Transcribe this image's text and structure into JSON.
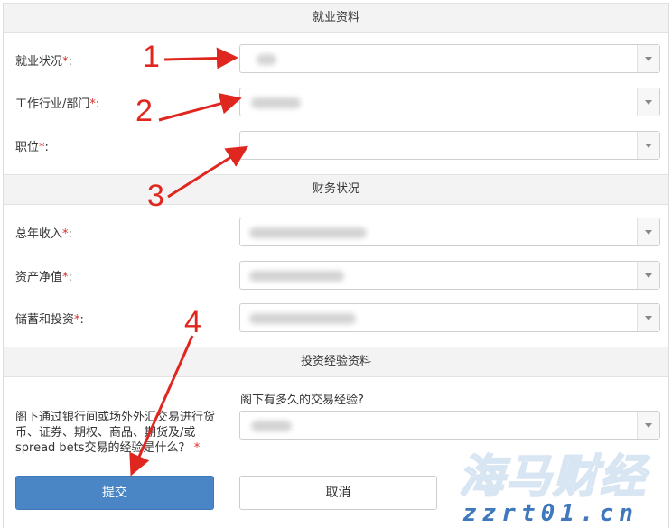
{
  "sections": {
    "employment": "就业资料",
    "financial": "财务状况",
    "experience": "投资经验资料"
  },
  "fields": {
    "employment_status": "就业状况",
    "industry": "工作行业/部门",
    "position": "职位",
    "annual_income": "总年收入",
    "net_worth": "资产净值",
    "savings": "储蓄和投资",
    "required_mark": "*",
    "colon": ":"
  },
  "experience": {
    "question1": "阁下通过银行间或场外外汇交易进行货币、证券、期权、商品、期货及/或spread bets交易的经验是什么？",
    "question2": "阁下有多久的交易经验?"
  },
  "buttons": {
    "submit": "提交",
    "cancel": "取消"
  },
  "annotations": [
    "1",
    "2",
    "3",
    "4"
  ],
  "watermark": {
    "main": "海马财经",
    "sub": "zzrt01.cn"
  },
  "colors": {
    "accent": "#4a86c6",
    "required": "#d9302a",
    "annotation": "#e0271f"
  }
}
